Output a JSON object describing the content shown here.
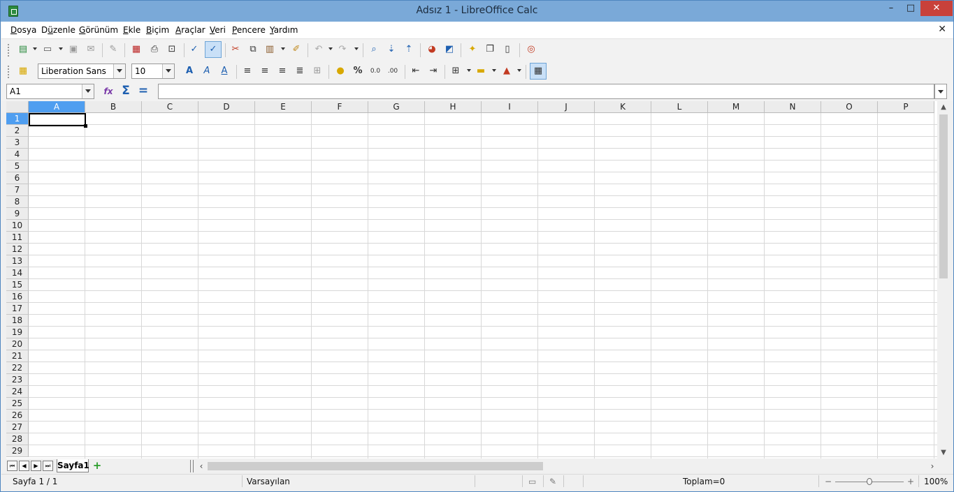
{
  "window": {
    "title": "Adsız 1 - LibreOffice Calc",
    "min": "–",
    "max": "□",
    "close": "✕"
  },
  "menu": {
    "items": [
      {
        "pre": "",
        "u": "D",
        "post": "osya"
      },
      {
        "pre": "D",
        "u": "ü",
        "post": "zenle"
      },
      {
        "pre": "",
        "u": "G",
        "post": "örünüm"
      },
      {
        "pre": "",
        "u": "E",
        "post": "kle"
      },
      {
        "pre": "",
        "u": "B",
        "post": "içim"
      },
      {
        "pre": "",
        "u": "A",
        "post": "raçlar"
      },
      {
        "pre": "",
        "u": "V",
        "post": "eri"
      },
      {
        "pre": "",
        "u": "P",
        "post": "encere"
      },
      {
        "pre": "",
        "u": "Y",
        "post": "ardım"
      }
    ],
    "doc_close": "✕"
  },
  "formatting": {
    "font_name": "Liberation Sans",
    "font_size": "10"
  },
  "formula_bar": {
    "name_box": "A1",
    "function_wizard": "fx",
    "sum": "Σ",
    "equals": "=",
    "value": ""
  },
  "columns": [
    "A",
    "B",
    "C",
    "D",
    "E",
    "F",
    "G",
    "H",
    "I",
    "J",
    "K",
    "L",
    "M",
    "N",
    "O",
    "P"
  ],
  "rows": [
    "1",
    "2",
    "3",
    "4",
    "5",
    "6",
    "7",
    "8",
    "9",
    "10",
    "11",
    "12",
    "13",
    "14",
    "15",
    "16",
    "17",
    "18",
    "19",
    "20",
    "21",
    "22",
    "23",
    "24",
    "25",
    "26",
    "27",
    "28",
    "29"
  ],
  "selected": {
    "column": "A",
    "row": "1"
  },
  "sheets": {
    "tabs": [
      "Sayfa1"
    ],
    "add": "+"
  },
  "status": {
    "sheet": "Sayfa 1 / 1",
    "style": "Varsayılan",
    "sum": "Toplam=0",
    "zoom": "100%",
    "zoom_minus": "−",
    "zoom_plus": "+"
  }
}
